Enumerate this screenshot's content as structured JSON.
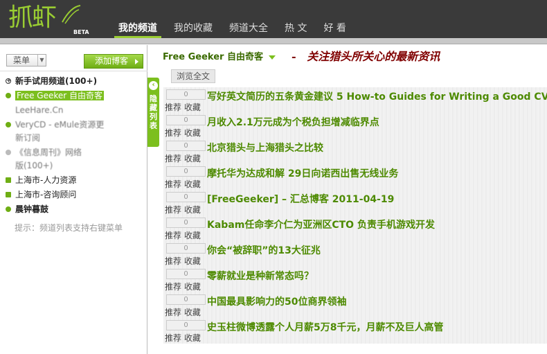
{
  "header": {
    "logo_text": "抓虾",
    "logo_badge": "BETA",
    "nav": [
      {
        "label": "我的频道",
        "active": true
      },
      {
        "label": "我的收藏",
        "active": false
      },
      {
        "label": "频道大全",
        "active": false
      },
      {
        "label": "热 文",
        "active": false
      },
      {
        "label": "好 看",
        "active": false
      }
    ]
  },
  "sidebar": {
    "menu_label": "菜单",
    "add_blog_label": "添加博客",
    "channels": [
      {
        "label": "新手试用频道(100+)",
        "icon": "plus-circle-icon"
      },
      {
        "label": "Free Geeker 自由奇客",
        "icon": "dot-icon"
      },
      {
        "label": "LeeHare.Cn",
        "icon": "none"
      },
      {
        "label": "VeryCD - eMule资源更新订阅",
        "icon": "dot-icon"
      },
      {
        "label": "《信息周刊》网络版(100+)",
        "icon": "dot-icon"
      },
      {
        "label": "上海市-人力资源",
        "icon": "lock-icon"
      },
      {
        "label": "上海市-咨询顾问",
        "icon": "lock-icon"
      },
      {
        "label": "晨钟暮鼓",
        "icon": "dot-icon"
      }
    ],
    "hint": "提示：频道列表支持右键菜单",
    "collapse_label": "隐藏列表"
  },
  "main": {
    "channel_title": "Free Geeker 自由奇客",
    "slogan_dash": "-",
    "slogan": "关注猎头所关心的最新资讯",
    "browse_all": "浏览全文",
    "recommend_label": "推荐",
    "favorite_label": "收藏",
    "articles": [
      {
        "count": "0",
        "title": "写好英文简历的五条黄金建议    5 How-to Guides for Writing a Good CV"
      },
      {
        "count": "0",
        "title": "月收入2.1万元成为个税负担增减临界点"
      },
      {
        "count": "0",
        "title": "北京猎头与上海猎头之比较"
      },
      {
        "count": "0",
        "title": "摩托华为达成和解 29日向诺西出售无线业务"
      },
      {
        "count": "0",
        "title": "[FreeGeeker] – 汇总博客 2011-04-19"
      },
      {
        "count": "0",
        "title": "Kabam任命李介仁为亚洲区CTO 负责手机游戏开发"
      },
      {
        "count": "0",
        "title": "你会“被辞职”的13大征兆"
      },
      {
        "count": "0",
        "title": "零薪就业是种新常态吗？"
      },
      {
        "count": "0",
        "title": "中国最具影响力的50位商界领袖"
      },
      {
        "count": "0",
        "title": "史玉柱微博透露个人月薪5万8千元，月薪不及巨人高管"
      }
    ]
  },
  "colors": {
    "brand_green": "#7cbf1e",
    "title_green": "#4d8a00",
    "slogan_red": "#800000",
    "header_bg": "#3a3a3a"
  }
}
